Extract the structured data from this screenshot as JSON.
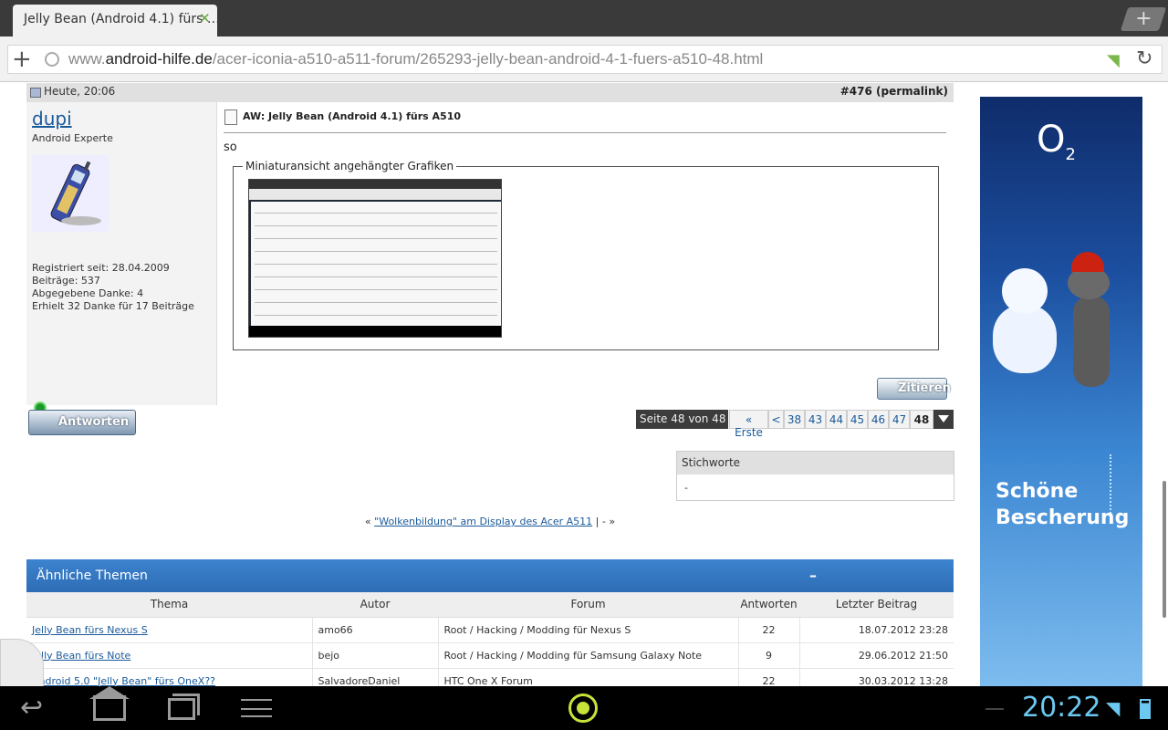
{
  "browser": {
    "tab_title": "Jelly Bean (Android 4.1) fürs …",
    "tab_close": "✕",
    "new_tab": "+",
    "url_prefix": "www.",
    "url_domain": "android-hilfe.de",
    "url_path": "/acer-iconia-a510-a511-forum/265293-jelly-bean-android-4-1-fuers-a510-48.html"
  },
  "post": {
    "date": "Heute, 20:06",
    "number_prefix": "#",
    "number": "476",
    "permalink": "(permalink)",
    "username": "dupi",
    "user_title": "Android Experte",
    "registered": "Registriert seit: 28.04.2009",
    "posts": "Beiträge: 537",
    "thanks_given": "Abgegebene Danke: 4",
    "thanks_received": "Erhielt 32 Danke für 17 Beiträge",
    "title": "AW: Jelly Bean (Android 4.1) fürs A510",
    "text": "so",
    "attachments_legend": "Miniaturansicht angehängter Grafiken",
    "quote_label": "Zitieren"
  },
  "reply_label": "Antworten",
  "pagination": {
    "label": "Seite 48 von 48",
    "first": "« Erste",
    "prev": "<",
    "pages": [
      "38",
      "43",
      "44",
      "45",
      "46",
      "47"
    ],
    "current": "48"
  },
  "tags": {
    "heading": "Stichworte",
    "value": "-"
  },
  "thread_nav": {
    "prev_marker": "«",
    "prev_link": "\"Wolkenbildung\" am Display des Acer A511",
    "sep": "| -",
    "next_marker": "»"
  },
  "similar": {
    "heading": "Ähnliche Themen",
    "collapse": "–",
    "columns": [
      "Thema",
      "Autor",
      "Forum",
      "Antworten",
      "Letzter Beitrag"
    ],
    "rows": [
      [
        "Jelly Bean fürs Nexus S",
        "amo66",
        "Root / Hacking / Modding für Nexus S",
        "22",
        "18.07.2012 23:28"
      ],
      [
        "Jelly Bean fürs Note",
        "bejo",
        "Root / Hacking / Modding für Samsung Galaxy Note",
        "9",
        "29.06.2012 21:50"
      ],
      [
        "Android 5.0 \"Jelly Bean\" fürs OneX??",
        "SalvadoreDaniel",
        "HTC One X Forum",
        "22",
        "30.03.2012 13:28"
      ]
    ]
  },
  "ad": {
    "logo": "O",
    "logo_sub": "2",
    "line1": "Schöne",
    "line2": "Bescherung"
  },
  "system": {
    "time": "20:22"
  }
}
